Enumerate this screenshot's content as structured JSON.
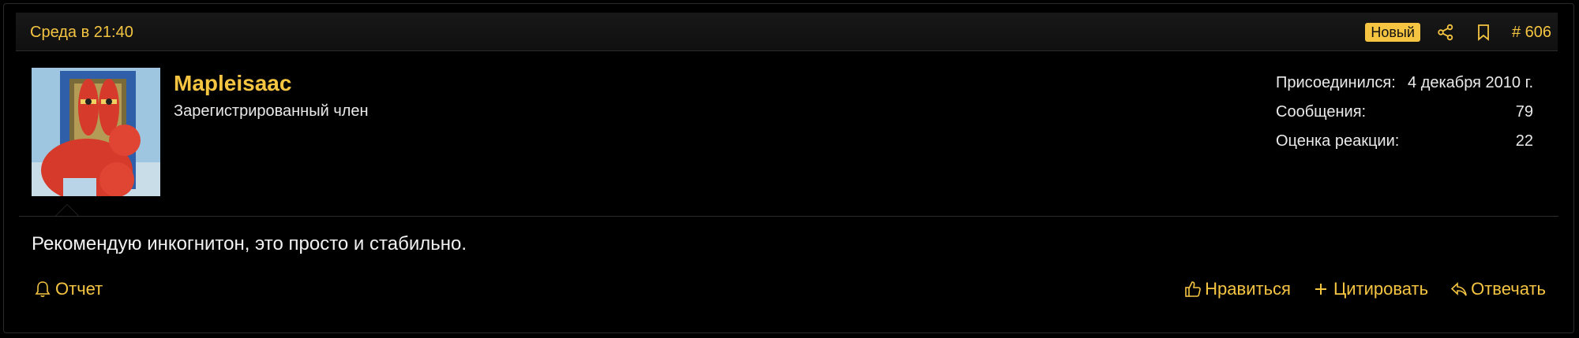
{
  "post": {
    "date": "Среда в 21:40",
    "badge": "Новый",
    "number": "# 606",
    "colors": {
      "accent": "#f5c542",
      "background": "#000000",
      "text": "#f2f2f2"
    }
  },
  "author": {
    "username": "Mapleisaac",
    "title": "Зарегистрированный член",
    "avatar_icon": "mr-krabs-avatar"
  },
  "stats": [
    {
      "label": "Присоединился:",
      "value": "4 декабря 2010 г."
    },
    {
      "label": "Сообщения:",
      "value": "79"
    },
    {
      "label": "Оценка реакции:",
      "value": "22"
    }
  ],
  "message": "Рекомендую инкогнитон, это просто и стабильно.",
  "actions": {
    "report": "Отчет",
    "like": "Нравиться",
    "quote": "Цитировать",
    "reply": "Отвечать"
  },
  "icons": {
    "share": "share-icon",
    "bookmark": "bookmark-icon",
    "bell": "bell-icon",
    "like": "thumbs-up-icon",
    "quote": "plus-icon",
    "reply": "reply-icon"
  }
}
